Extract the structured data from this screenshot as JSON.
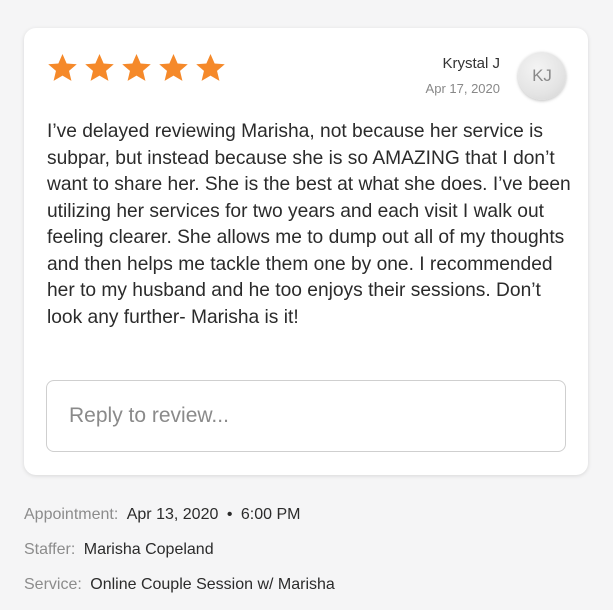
{
  "review": {
    "rating": 5,
    "star_color": "#f5892a",
    "reviewer_name": "Krystal J",
    "date": "Apr 17, 2020",
    "initials": "KJ",
    "text": "I’ve delayed reviewing Marisha, not because her service is subpar, but instead because she is so AMAZING that I don’t want to share her. She is the best at what she does. I’ve been utilizing her services for two years and each visit I walk out feeling clearer. She allows me to dump out all of my thoughts and then helps me tackle them one by one. I recommended her to my husband and he too enjoys their sessions. Don’t look any further- Marisha is it!",
    "reply_placeholder": "Reply to review...",
    "reply_value": ""
  },
  "details": {
    "appointment_label": "Appointment:",
    "appointment_date": "Apr 13, 2020",
    "bullet": "•",
    "appointment_time": "6:00 PM",
    "staffer_label": "Staffer:",
    "staffer_value": "Marisha Copeland",
    "service_label": "Service:",
    "service_value": "Online Couple Session w/ Marisha"
  },
  "icons": {
    "star": "star-icon"
  }
}
